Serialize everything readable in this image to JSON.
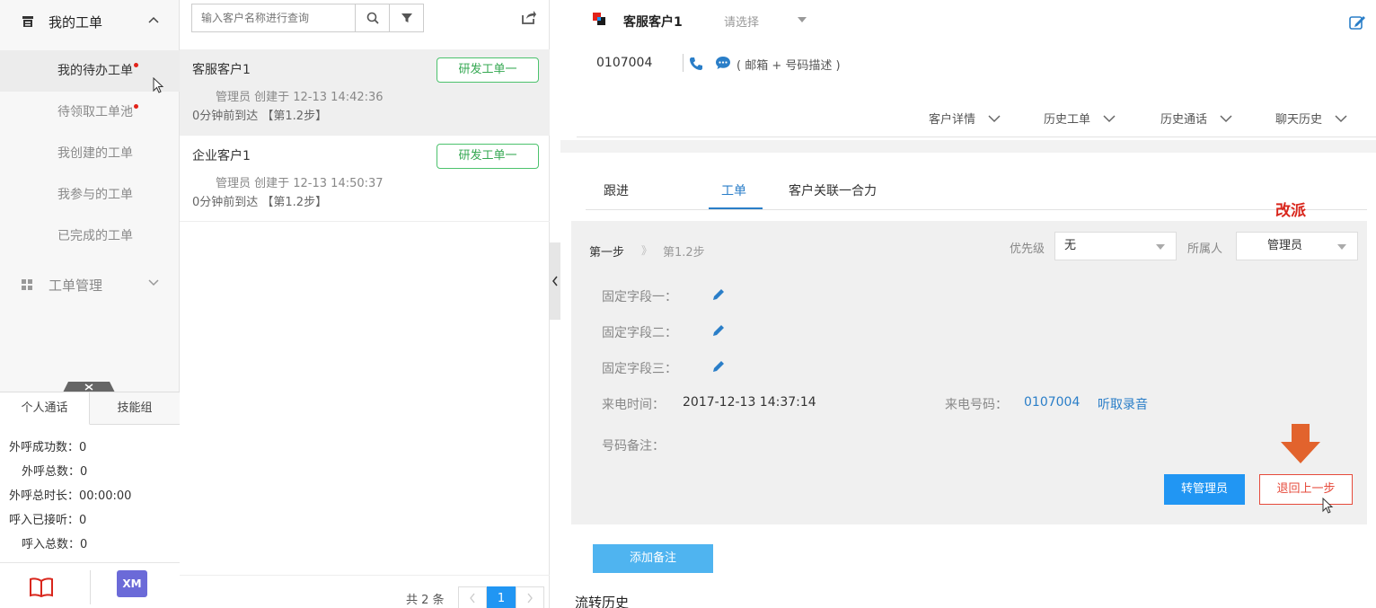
{
  "sidebar": {
    "my_tickets_label": "我的工单",
    "items": [
      {
        "label": "我的待办工单",
        "dot": true
      },
      {
        "label": "待领取工单池",
        "dot": true
      },
      {
        "label": "我创建的工单",
        "dot": false
      },
      {
        "label": "我参与的工单",
        "dot": false
      },
      {
        "label": "已完成的工单",
        "dot": false
      }
    ],
    "management_label": "工单管理",
    "stats_tabs": [
      "个人通话",
      "技能组"
    ],
    "stats": [
      {
        "label": "外呼成功数：",
        "value": "0"
      },
      {
        "label": "外呼总数：",
        "value": "0"
      },
      {
        "label": "外呼总时长：",
        "value": "00:00:00"
      },
      {
        "label": "呼入已接听：",
        "value": "0"
      },
      {
        "label": "呼入总数：",
        "value": "0"
      }
    ],
    "xm_label": "XM"
  },
  "list": {
    "search_placeholder": "输入客户名称进行查询",
    "tickets": [
      {
        "name": "客服客户1",
        "tag": "研发工单一",
        "meta": "管理员 创建于 12-13 14:42:36",
        "arrive": "0分钟前到达 【第1.2步】"
      },
      {
        "name": "企业客户1",
        "tag": "研发工单一",
        "meta": "管理员 创建于 12-13 14:50:37",
        "arrive": "0分钟前到达 【第1.2步】"
      }
    ],
    "pager": {
      "total": "共 2 条",
      "current": "1"
    }
  },
  "customer": {
    "name": "客服客户1",
    "select_placeholder": "请选择",
    "phone": "0107004",
    "mail_desc": "( 邮箱 + 号码描述 )",
    "history_links": [
      "客户详情",
      "历史工单",
      "历史通话",
      "聊天历史"
    ]
  },
  "panel": {
    "tabs": [
      "跟进",
      "工单",
      "客户关联一合力"
    ],
    "active_tab": 1,
    "reassign_note": "改派",
    "step_current": "第一步",
    "step_sep": "》",
    "step_next": "第1.2步",
    "priority_label": "优先级",
    "priority_value": "无",
    "owner_label": "所属人",
    "owner_value": "管理员",
    "fixed_fields": [
      "固定字段一：",
      "固定字段二：",
      "固定字段三："
    ],
    "call_time_label": "来电时间：",
    "call_time_value": "2017-12-13 14:37:14",
    "call_number_label": "来电号码：",
    "call_number_value": "0107004",
    "listen_label": "听取录音",
    "number_note_label": "号码备注：",
    "transfer_button": "转管理员",
    "back_button": "退回上一步",
    "add_note_button": "添加备注",
    "flow_history": "流转历史"
  },
  "colors": {
    "accent_blue": "#2196f3",
    "tag_green": "#35a852",
    "annotation_red": "#d9261c",
    "dot_red": "#e2231a"
  }
}
